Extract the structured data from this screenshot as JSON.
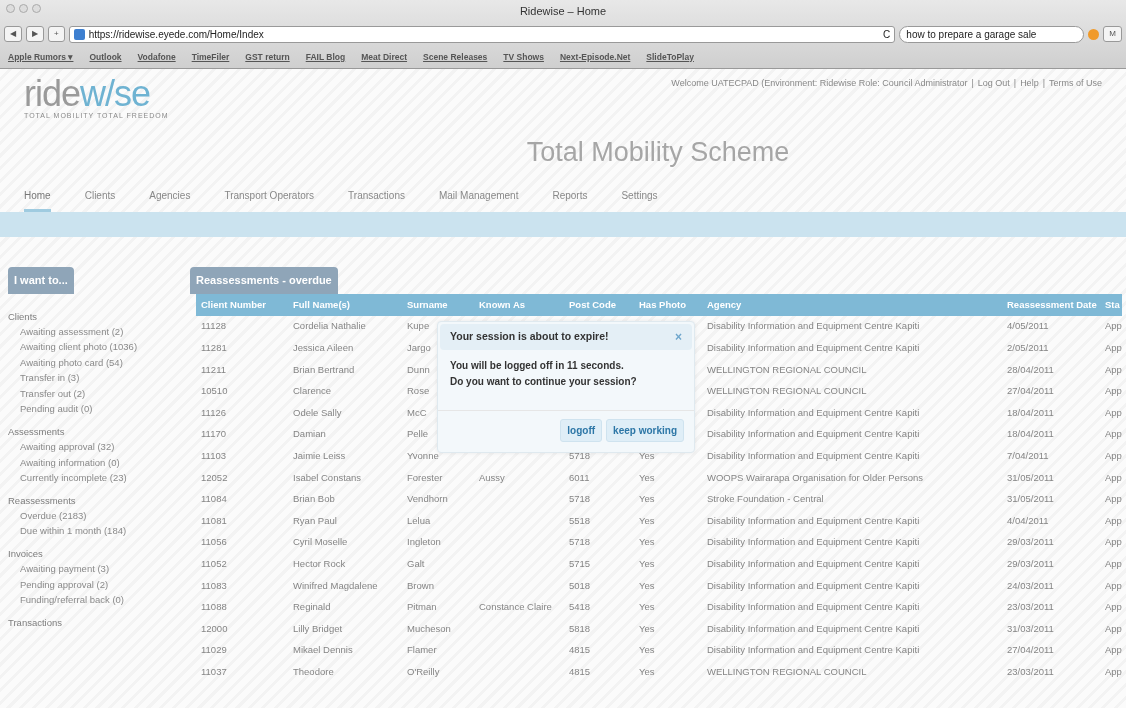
{
  "window": {
    "title": "Ridewise – Home"
  },
  "toolbar": {
    "back": "◀",
    "forward": "▶",
    "add": "+",
    "url": "https://ridewise.eyede.com/Home/Index",
    "reload": "C",
    "search_value": "how to prepare a garage sale",
    "menu_key": "M"
  },
  "bookmarks": [
    "Apple Rumors ▾",
    "Outlook",
    "Vodafone",
    "TimeFiler",
    "GST return",
    "FAIL Blog",
    "Meat Direct",
    "Scene Releases",
    "TV Shows",
    "Next-Episode.Net",
    "SlideToPlay"
  ],
  "header": {
    "logo_dark": "ride",
    "logo_light": "w/se",
    "tagline": "TOTAL MOBILITY TOTAL FREEDOM",
    "welcome": "Welcome UATECPAD (Environment: Ridewise Role: Council Administrator",
    "links": [
      "Log Out",
      "Help",
      "Terms of Use"
    ],
    "separators": [
      "|",
      "|",
      "|"
    ],
    "title": "Total Mobility Scheme"
  },
  "nav": [
    {
      "label": "Home",
      "selected": true
    },
    {
      "label": "Clients",
      "selected": false
    },
    {
      "label": "Agencies",
      "selected": false
    },
    {
      "label": "Transport Operators",
      "selected": false
    },
    {
      "label": "Transactions",
      "selected": false
    },
    {
      "label": "Mail Management",
      "selected": false
    },
    {
      "label": "Reports",
      "selected": false
    },
    {
      "label": "Settings",
      "selected": false
    }
  ],
  "sidebar": {
    "title": "I want to...",
    "sections": [
      {
        "heading": "Clients",
        "items": [
          "Awaiting assessment (2)",
          "Awaiting client photo (1036)",
          "Awaiting photo card (54)",
          "Transfer in (3)",
          "Transfer out (2)",
          "Pending audit (0)"
        ]
      },
      {
        "heading": "Assessments",
        "items": [
          "Awaiting approval (32)",
          "Awaiting information (0)",
          "Currently incomplete (23)"
        ]
      },
      {
        "heading": "Reassessments",
        "items": [
          "Overdue (2183)",
          "Due within 1 month (184)"
        ]
      },
      {
        "heading": "Invoices",
        "items": [
          "Awaiting payment (3)",
          "Pending approval (2)",
          "Funding/referral back (0)"
        ]
      },
      {
        "heading": "Transactions"
      }
    ]
  },
  "panel": {
    "title": "Reassessments - overdue"
  },
  "table": {
    "columns": [
      "Client Number",
      "Full Name(s)",
      "Surname",
      "Known As",
      "Post Code",
      "Has Photo",
      "Agency",
      "Reassessment Date",
      "Sta"
    ],
    "rows": [
      {
        "client_number": "11128",
        "full_names": "Cordelia Nathalie",
        "surname": "Kupe",
        "agency": "Disability Information and Equipment Centre Kapiti",
        "reassessment_date": "4/05/2011",
        "status": "App"
      },
      {
        "client_number": "11281",
        "full_names": "Jessica Aileen",
        "surname": "Jargo",
        "agency": "Disability Information and Equipment Centre Kapiti",
        "reassessment_date": "2/05/2011",
        "status": "App"
      },
      {
        "client_number": "11211",
        "full_names": "Brian Bertrand",
        "surname": "Dunn",
        "agency": "WELLINGTON REGIONAL COUNCIL",
        "reassessment_date": "28/04/2011",
        "status": "App"
      },
      {
        "client_number": "10510",
        "full_names": "Clarence",
        "surname": "Rose",
        "agency": "WELLINGTON REGIONAL COUNCIL",
        "reassessment_date": "27/04/2011",
        "status": "App"
      },
      {
        "client_number": "11126",
        "full_names": "Odele Sally",
        "surname": "McC",
        "agency": "Disability Information and Equipment Centre Kapiti",
        "reassessment_date": "18/04/2011",
        "status": "App"
      },
      {
        "client_number": "11170",
        "full_names": "Damian",
        "surname": "Pelle",
        "agency": "Disability Information and Equipment Centre Kapiti",
        "reassessment_date": "18/04/2011",
        "status": "App"
      },
      {
        "client_number": "11103",
        "full_names": "Jaimie Leiss",
        "surname": "Yvonne",
        "post_code": "5718",
        "has_photo": "Yes",
        "agency": "Disability Information and Equipment Centre Kapiti",
        "reassessment_date": "7/04/2011",
        "status": "App"
      },
      {
        "client_number": "12052",
        "full_names": "Isabel Constans",
        "surname": "Forester",
        "known_as": "Aussy",
        "post_code": "6011",
        "has_photo": "Yes",
        "agency": "WOOPS Wairarapa Organisation for Older Persons",
        "reassessment_date": "31/05/2011",
        "status": "App"
      },
      {
        "client_number": "11084",
        "full_names": "Brian Bob",
        "surname": "Vendhorn",
        "post_code": "5718",
        "has_photo": "Yes",
        "agency": "Stroke Foundation - Central",
        "reassessment_date": "31/05/2011",
        "status": "App"
      },
      {
        "client_number": "11081",
        "full_names": "Ryan Paul",
        "surname": "Lelua",
        "post_code": "5518",
        "has_photo": "Yes",
        "agency": "Disability Information and Equipment Centre Kapiti",
        "reassessment_date": "4/04/2011",
        "status": "App"
      },
      {
        "client_number": "11056",
        "full_names": "Cyril Moselle",
        "surname": "Ingleton",
        "post_code": "5718",
        "has_photo": "Yes",
        "agency": "Disability Information and Equipment Centre Kapiti",
        "reassessment_date": "29/03/2011",
        "status": "App"
      },
      {
        "client_number": "11052",
        "full_names": "Hector Rock",
        "surname": "Galt",
        "post_code": "5715",
        "has_photo": "Yes",
        "agency": "Disability Information and Equipment Centre Kapiti",
        "reassessment_date": "29/03/2011",
        "status": "App"
      },
      {
        "client_number": "11083",
        "full_names": "Winifred Magdalene",
        "surname": "Brown",
        "post_code": "5018",
        "has_photo": "Yes",
        "agency": "Disability Information and Equipment Centre Kapiti",
        "reassessment_date": "24/03/2011",
        "status": "App"
      },
      {
        "client_number": "11088",
        "full_names": "Reginald",
        "surname": "Pitman",
        "known_as": "Constance Claire",
        "post_code": "5418",
        "has_photo": "Yes",
        "agency": "Disability Information and Equipment Centre Kapiti",
        "reassessment_date": "23/03/2011",
        "status": "App"
      },
      {
        "client_number": "12000",
        "full_names": "Lilly Bridget",
        "surname": "Mucheson",
        "post_code": "5818",
        "has_photo": "Yes",
        "agency": "Disability Information and Equipment Centre Kapiti",
        "reassessment_date": "31/03/2011",
        "status": "App"
      },
      {
        "client_number": "11029",
        "full_names": "Mikael Dennis",
        "surname": "Flamer",
        "post_code": "4815",
        "has_photo": "Yes",
        "agency": "Disability Information and Equipment Centre Kapiti",
        "reassessment_date": "27/04/2011",
        "status": "App"
      },
      {
        "client_number": "11037",
        "full_names": "Theodore",
        "surname": "O'Reilly",
        "post_code": "4815",
        "has_photo": "Yes",
        "agency": "WELLINGTON REGIONAL COUNCIL",
        "reassessment_date": "23/03/2011",
        "status": "App"
      }
    ]
  },
  "dialog": {
    "title": "Your session is about to expire!",
    "close": "×",
    "lines": [
      "You will be logged off in 11 seconds.",
      "Do you want to continue your session?"
    ],
    "buttons": [
      "logoff",
      "keep working"
    ]
  }
}
